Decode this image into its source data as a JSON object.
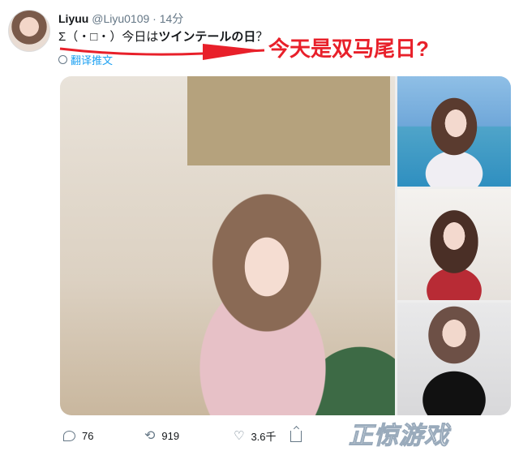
{
  "tweet": {
    "name": "Liyuu",
    "handle": "@Liyu0109",
    "dot": "·",
    "time": "14分",
    "text_prefix": "Σ（・□・）今日は",
    "text_keyword": "ツインテールの日",
    "text_suffix": "？",
    "translate_label": "翻译推文"
  },
  "annotation": {
    "text": "今天是双马尾日?",
    "color": "#e8202a"
  },
  "actions": {
    "replies": "76",
    "retweets": "919",
    "likes": "3.6千"
  },
  "watermark": {
    "text": "正惊游戏"
  },
  "colors": {
    "accent": "#1da1f2",
    "muted": "#657786",
    "annotation_red": "#e8202a"
  }
}
